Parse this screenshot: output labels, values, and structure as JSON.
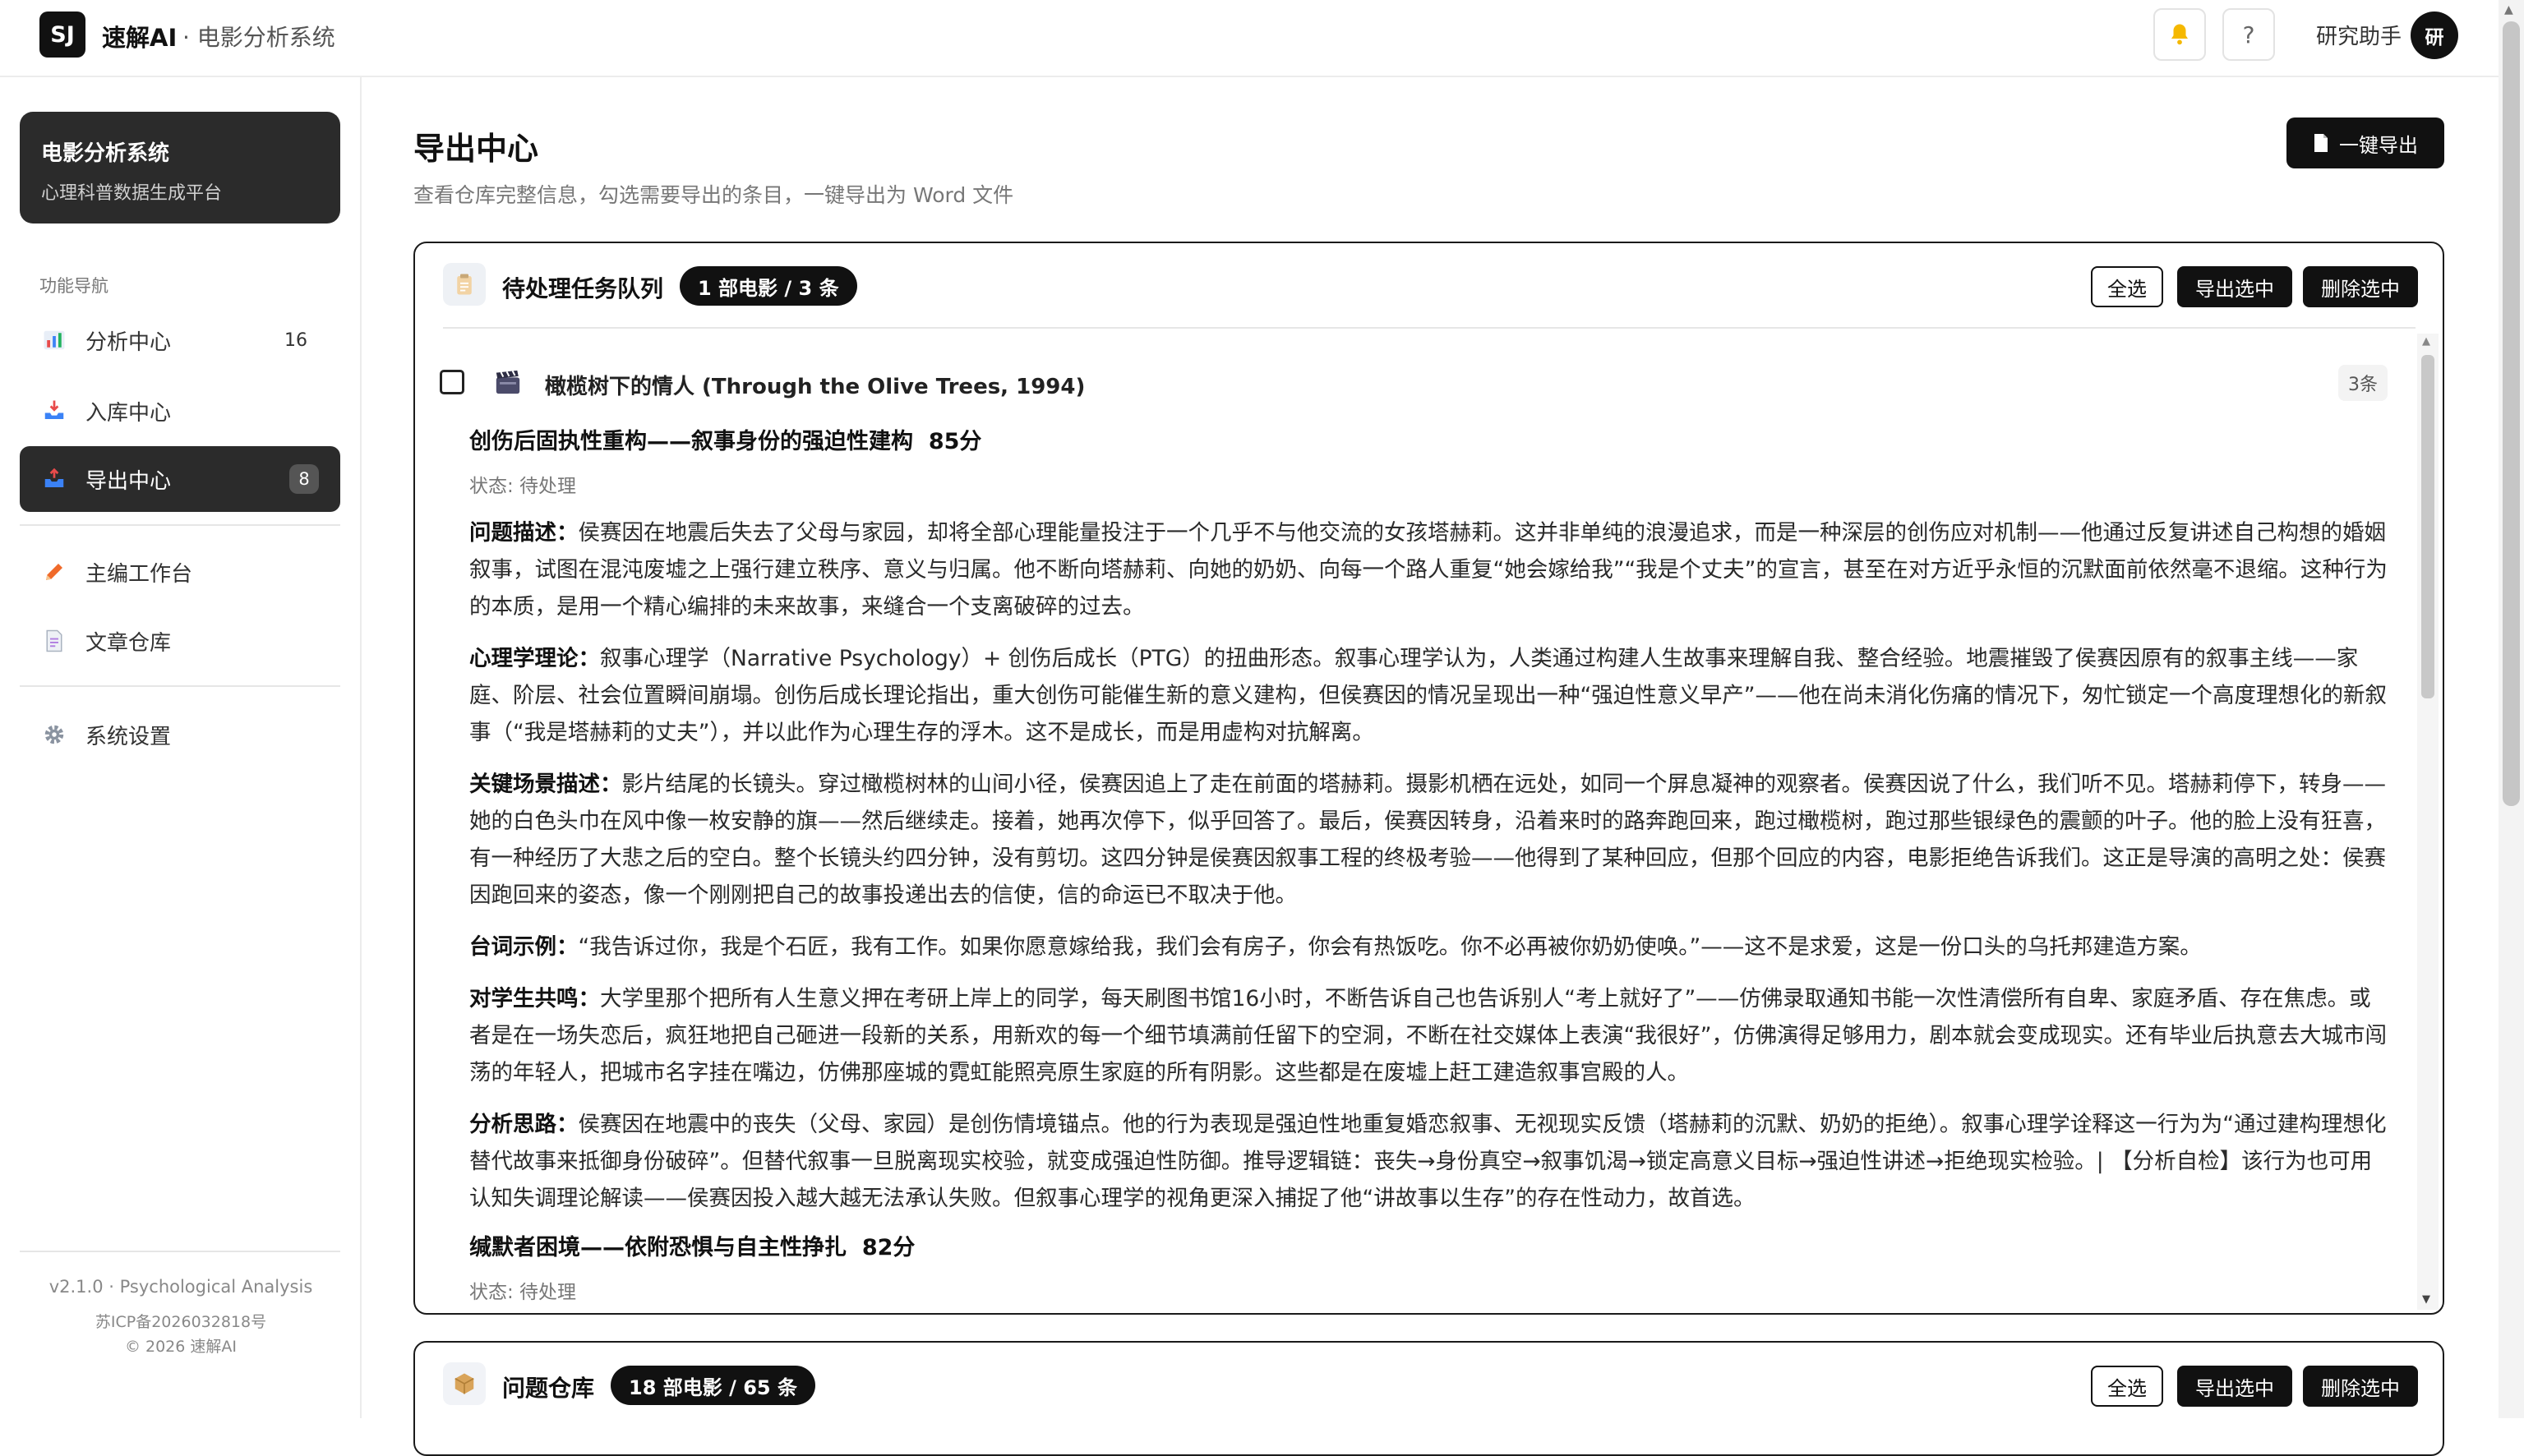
{
  "topbar": {
    "logo": "SJ",
    "brand": "速解AI",
    "subtitle": "· 电影分析系统",
    "help": "?",
    "user_name": "研究助手",
    "avatar": "研"
  },
  "sidebar": {
    "card_title": "电影分析系统",
    "card_sub": "心理科普数据生成平台",
    "nav_heading": "功能导航",
    "items": [
      {
        "label": "分析中心",
        "count": "16",
        "icon": "bar-chart-icon"
      },
      {
        "label": "入库中心",
        "count": "",
        "icon": "inbox-icon"
      },
      {
        "label": "导出中心",
        "count": "8",
        "icon": "export-icon",
        "active": true
      },
      {
        "label": "主编工作台",
        "count": "",
        "icon": "pencil-icon"
      },
      {
        "label": "文章仓库",
        "count": "",
        "icon": "document-icon"
      },
      {
        "label": "系统设置",
        "count": "",
        "icon": "gear-icon"
      }
    ],
    "version": "v2.1.0 · Psychological Analysis",
    "icp": "苏ICP备2026032818号",
    "copyright": "© 2026 速解AI"
  },
  "main": {
    "title": "导出中心",
    "description": "查看仓库完整信息，勾选需要导出的条目，一键导出为 Word 文件",
    "export_all": "一键导出"
  },
  "panel1": {
    "title": "待处理任务队列",
    "pill": "1 部电影 / 3 条",
    "select_all": "全选",
    "export_selected": "导出选中",
    "delete_selected": "删除选中",
    "movie": {
      "title": "橄榄树下的情人 (Through the Olive Trees, 1994)",
      "count": "3条"
    },
    "item1": {
      "title": "创伤后固执性重构——叙事身份的强迫性建构",
      "score": "85分",
      "status": "状态: 待处理",
      "sections": [
        {
          "label": "问题描述：",
          "text": "侯赛因在地震后失去了父母与家园，却将全部心理能量投注于一个几乎不与他交流的女孩塔赫莉。这并非单纯的浪漫追求，而是一种深层的创伤应对机制——他通过反复讲述自己构想的婚姻叙事，试图在混沌废墟之上强行建立秩序、意义与归属。他不断向塔赫莉、向她的奶奶、向每一个路人重复“她会嫁给我”“我是个丈夫”的宣言，甚至在对方近乎永恒的沉默面前依然毫不退缩。这种行为的本质，是用一个精心编排的未来故事，来缝合一个支离破碎的过去。"
        },
        {
          "label": "心理学理论：",
          "text": "叙事心理学（Narrative Psychology）+ 创伤后成长（PTG）的扭曲形态。叙事心理学认为，人类通过构建人生故事来理解自我、整合经验。地震摧毁了侯赛因原有的叙事主线——家庭、阶层、社会位置瞬间崩塌。创伤后成长理论指出，重大创伤可能催生新的意义建构，但侯赛因的情况呈现出一种“强迫性意义早产”——他在尚未消化伤痛的情况下，匆忙锁定一个高度理想化的新叙事（“我是塔赫莉的丈夫”），并以此作为心理生存的浮木。这不是成长，而是用虚构对抗解离。"
        },
        {
          "label": "关键场景描述：",
          "text": "影片结尾的长镜头。穿过橄榄树林的山间小径，侯赛因追上了走在前面的塔赫莉。摄影机栖在远处，如同一个屏息凝神的观察者。侯赛因说了什么，我们听不见。塔赫莉停下，转身——她的白色头巾在风中像一枚安静的旗——然后继续走。接着，她再次停下，似乎回答了。最后，侯赛因转身，沿着来时的路奔跑回来，跑过橄榄树，跑过那些银绿色的震颤的叶子。他的脸上没有狂喜，有一种经历了大悲之后的空白。整个长镜头约四分钟，没有剪切。这四分钟是侯赛因叙事工程的终极考验——他得到了某种回应，但那个回应的内容，电影拒绝告诉我们。这正是导演的高明之处：侯赛因跑回来的姿态，像一个刚刚把自己的故事投递出去的信使，信的命运已不取决于他。"
        },
        {
          "label": "台词示例：",
          "text": "“我告诉过你，我是个石匠，我有工作。如果你愿意嫁给我，我们会有房子，你会有热饭吃。你不必再被你奶奶使唤。”——这不是求爱，这是一份口头的乌托邦建造方案。"
        },
        {
          "label": "对学生共鸣：",
          "text": "大学里那个把所有人生意义押在考研上岸上的同学，每天刷图书馆16小时，不断告诉自己也告诉别人“考上就好了”——仿佛录取通知书能一次性清偿所有自卑、家庭矛盾、存在焦虑。或者是在一场失恋后，疯狂地把自己砸进一段新的关系，用新欢的每一个细节填满前任留下的空洞，不断在社交媒体上表演“我很好”，仿佛演得足够用力，剧本就会变成现实。还有毕业后执意去大城市闯荡的年轻人，把城市名字挂在嘴边，仿佛那座城的霓虹能照亮原生家庭的所有阴影。这些都是在废墟上赶工建造叙事宫殿的人。"
        },
        {
          "label": "分析思路：",
          "text": "侯赛因在地震中的丧失（父母、家园）是创伤情境锚点。他的行为表现是强迫性地重复婚恋叙事、无视现实反馈（塔赫莉的沉默、奶奶的拒绝）。叙事心理学诠释这一行为为“通过建构理想化替代故事来抵御身份破碎”。但替代叙事一旦脱离现实校验，就变成强迫性防御。推导逻辑链：丧失→身份真空→叙事饥渴→锁定高意义目标→强迫性讲述→拒绝现实检验。| 【分析自检】该行为也可用认知失调理论解读——侯赛因投入越大越无法承认失败。但叙事心理学的视角更深入捕捉了他“讲故事以生存”的存在性动力，故首选。"
        }
      ]
    },
    "item2": {
      "title": "缄默者困境——依附恐惧与自主性挣扎",
      "score": "82分",
      "status": "状态: 待处理"
    }
  },
  "panel2": {
    "title": "问题仓库",
    "pill": "18 部电影 / 65 条",
    "select_all": "全选",
    "export_selected": "导出选中",
    "delete_selected": "删除选中"
  }
}
